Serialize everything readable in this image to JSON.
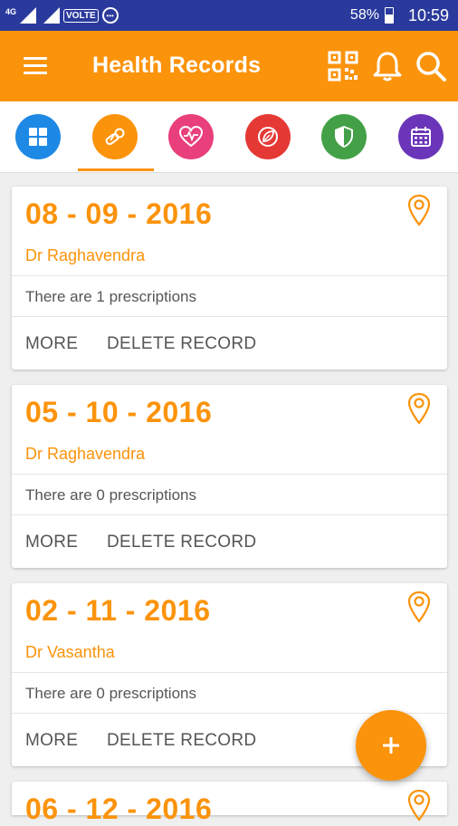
{
  "status_bar": {
    "network": "4G",
    "volte": "VOLTE",
    "battery": "58%",
    "time": "10:59"
  },
  "app_bar": {
    "title": "Health Records"
  },
  "categories": [
    {
      "icon": "grid-icon",
      "color": "#1e88e5",
      "active": false
    },
    {
      "icon": "pills-icon",
      "color": "#fb930b",
      "active": true
    },
    {
      "icon": "heart-icon",
      "color": "#e93f7b",
      "active": false
    },
    {
      "icon": "leaf-icon",
      "color": "#e53935",
      "active": false
    },
    {
      "icon": "shield-icon",
      "color": "#43a047",
      "active": false
    },
    {
      "icon": "calendar-icon",
      "color": "#6a35b8",
      "active": false
    }
  ],
  "records": [
    {
      "date": "08 - 09 - 2016",
      "doctor": "Dr Raghavendra",
      "prescriptions": "There are 1 prescriptions",
      "more": "MORE",
      "delete": "DELETE RECORD"
    },
    {
      "date": "05 - 10 - 2016",
      "doctor": "Dr Raghavendra",
      "prescriptions": "There are 0 prescriptions",
      "more": "MORE",
      "delete": "DELETE RECORD"
    },
    {
      "date": "02 - 11 - 2016",
      "doctor": "Dr Vasantha",
      "prescriptions": "There are 0 prescriptions",
      "more": "MORE",
      "delete": "DELETE RECORD"
    },
    {
      "date": "06 - 12 - 2016"
    }
  ],
  "fab": {
    "icon": "plus-icon"
  },
  "colors": {
    "primary": "#fb930b",
    "status_bar": "#2a3a9c",
    "background": "#efefef"
  }
}
